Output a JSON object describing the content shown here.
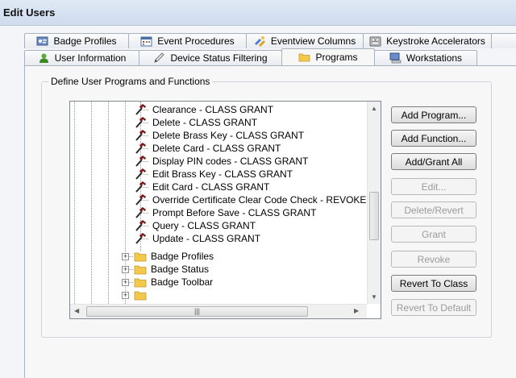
{
  "window": {
    "title": "Edit Users"
  },
  "tabs_back": [
    {
      "label": "Badge Profiles",
      "icon": "badge-profiles-icon"
    },
    {
      "label": "Event Procedures",
      "icon": "calendar-icon"
    },
    {
      "label": "Eventview Columns",
      "icon": "columns-icon"
    },
    {
      "label": "Keystroke Accelerators",
      "icon": "keyboard-icon"
    }
  ],
  "tabs_front": [
    {
      "label": "User Information",
      "icon": "user-icon"
    },
    {
      "label": "Device Status Filtering",
      "icon": "pencil-icon"
    },
    {
      "label": "Programs",
      "icon": "folder-icon",
      "active": true
    },
    {
      "label": "Workstations",
      "icon": "workstation-icon"
    }
  ],
  "group": {
    "legend": "Define User Programs and Functions"
  },
  "tree": {
    "functions": [
      "Clearance  - CLASS GRANT",
      "Delete  - CLASS GRANT",
      "Delete Brass Key  - CLASS GRANT",
      "Delete Card  - CLASS GRANT",
      "Display PIN codes  - CLASS GRANT",
      "Edit Brass Key  - CLASS GRANT",
      "Edit Card  - CLASS GRANT",
      "Override Certificate Clear Code Check  - REVOKE",
      "Prompt Before Save  - CLASS GRANT",
      "Query  - CLASS GRANT",
      "Update  - CLASS GRANT"
    ],
    "programs": [
      "Badge Profiles",
      "Badge Status",
      "Badge Toolbar"
    ]
  },
  "buttons": {
    "add_program": "Add Program...",
    "add_function": "Add Function...",
    "add_grant_all": "Add/Grant All",
    "edit": "Edit...",
    "delete_revert": "Delete/Revert",
    "grant": "Grant",
    "revoke": "Revoke",
    "revert_to_class": "Revert To Class",
    "revert_to_default": "Revert To Default"
  },
  "colors": {
    "hammer_head": "#7a1a1a",
    "hammer_handle": "#2a2a2a",
    "folder": "#f3c94c",
    "active_tab": "#f7f7f7"
  }
}
